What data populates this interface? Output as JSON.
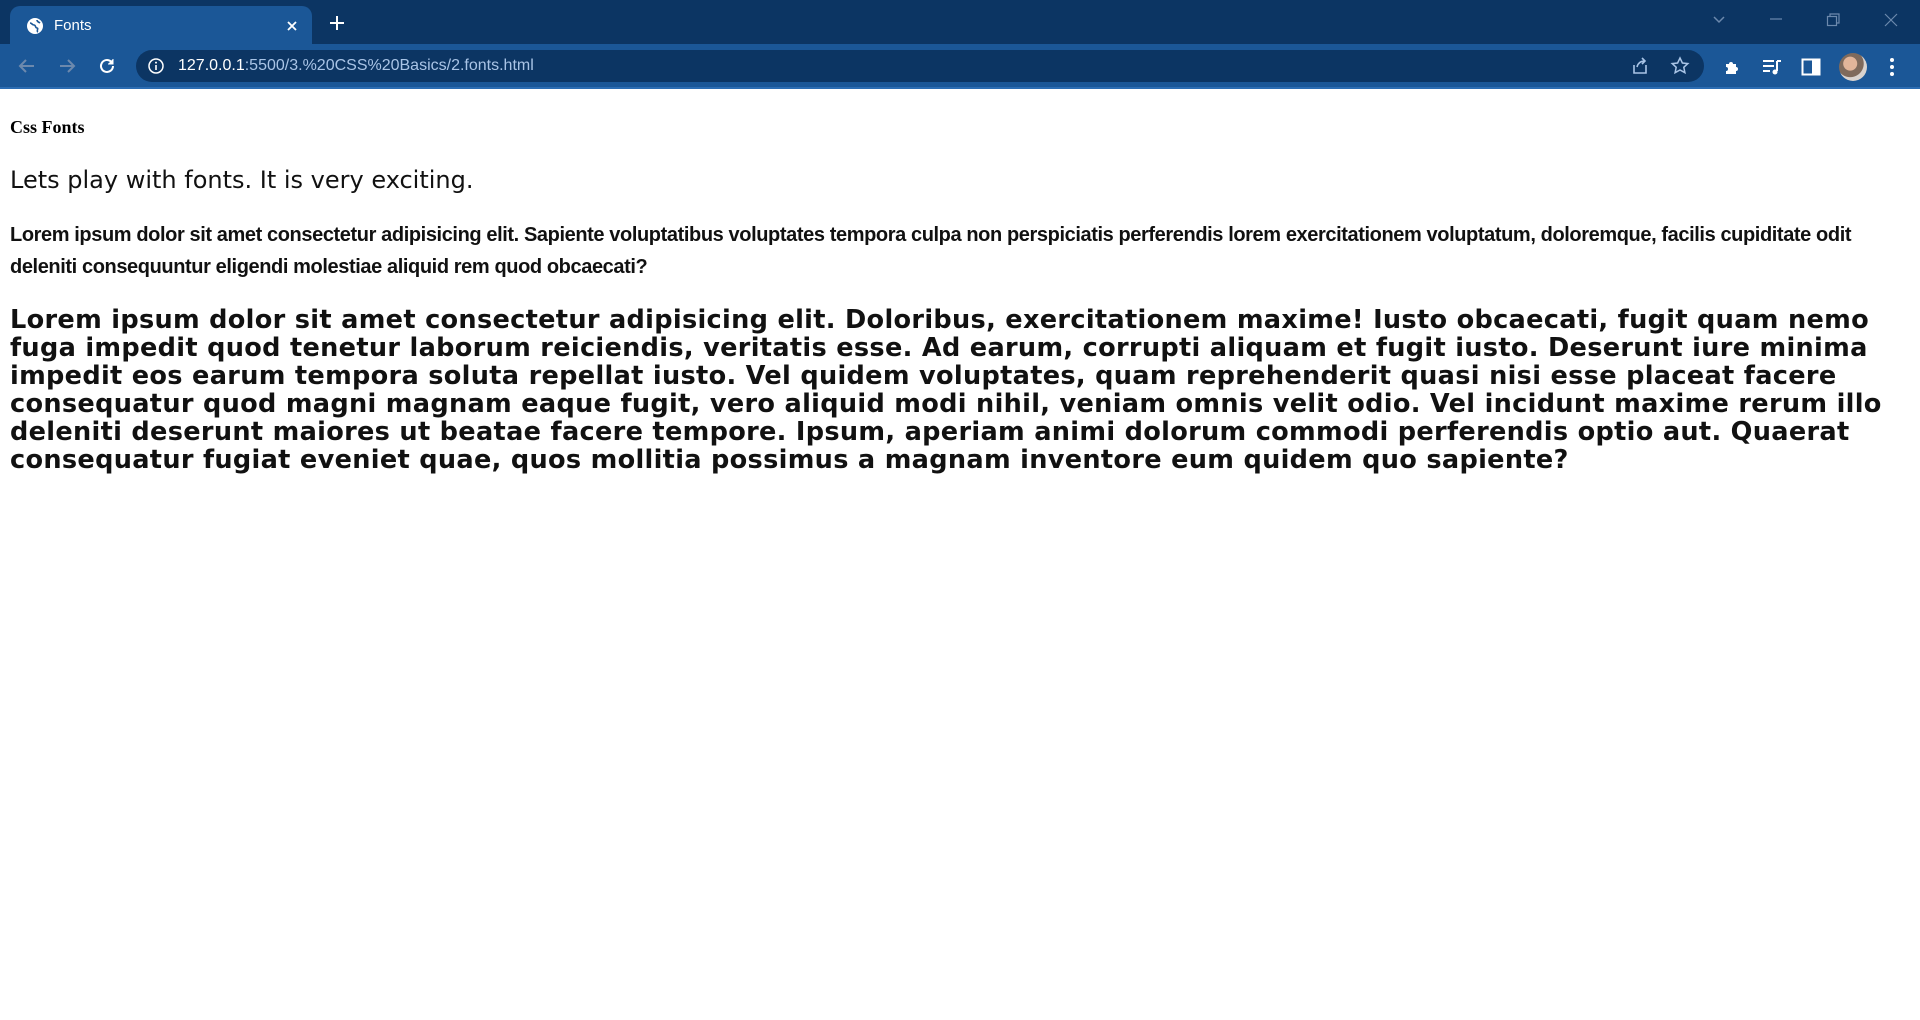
{
  "browser": {
    "tab": {
      "title": "Fonts",
      "favicon": "globe-icon",
      "close_icon": "close-icon"
    },
    "new_tab_icon": "plus-icon",
    "window_controls": [
      "tab-search-icon",
      "minimize-icon",
      "restore-icon",
      "close-icon"
    ],
    "toolbar": {
      "back_icon": "back-arrow-icon",
      "forward_icon": "forward-arrow-icon",
      "reload_icon": "reload-icon",
      "url_host": "127.0.0.1",
      "url_path": ":5500/3.%20CSS%20Basics/2.fonts.html",
      "omnibox_icons": [
        "share-icon",
        "bookmark-star-icon"
      ],
      "right_icons": [
        "extensions-icon",
        "media-queue-icon",
        "side-panel-icon",
        "avatar",
        "menu-icon"
      ]
    },
    "colors": {
      "tabstrip": "#0c3563",
      "active_tab": "#1b5797",
      "omnibox": "#0c3563",
      "page_bg": "#ffffff"
    }
  },
  "page": {
    "heading": "Css Fonts",
    "intro": "Lets play with fonts. It is very exciting.",
    "para2_before_bold": "Lorem ipsum dolor sit amet consectetur adipisicing elit. Sapiente voluptatibus voluptates tempora culpa non perspiciatis perferendis ",
    "para2_bold": "lorem",
    "para2_after_bold": " exercitationem voluptatum, doloremque, facilis cupiditate odit deleniti consequuntur eligendi molestiae aliquid rem quod obcaecati?",
    "para3": "Lorem ipsum dolor sit amet consectetur adipisicing elit. Doloribus, exercitationem maxime! Iusto obcaecati, fugit quam nemo fuga impedit quod tenetur laborum reiciendis, veritatis esse. Ad earum, corrupti aliquam et fugit iusto. Deserunt iure minima impedit eos earum tempora soluta repellat iusto. Vel quidem voluptates, quam reprehenderit quasi nisi esse placeat facere consequatur quod magni magnam eaque fugit, vero aliquid modi nihil, veniam omnis velit odio. Vel incidunt maxime rerum illo deleniti deserunt maiores ut beatae facere tempore. Ipsum, aperiam animi dolorum commodi perferendis optio aut. Quaerat consequatur fugiat eveniet quae, quos mollitia possimus a magnam inventore eum quidem quo sapiente?"
  }
}
